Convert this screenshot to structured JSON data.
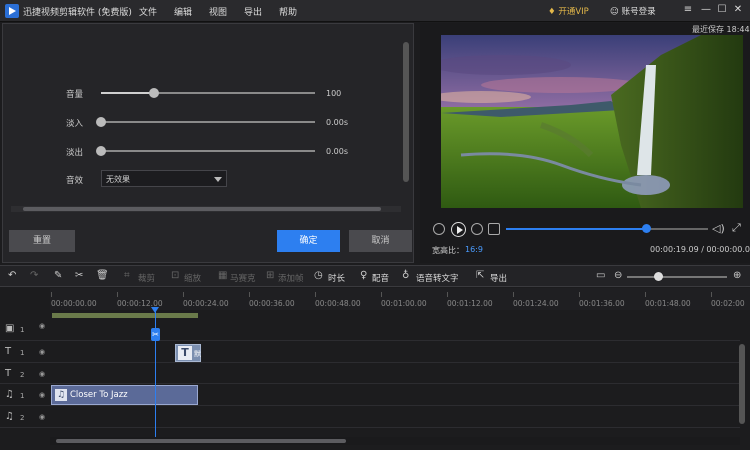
{
  "app": {
    "title": "迅捷视频剪辑软件 (免费版)"
  },
  "menu": [
    "文件",
    "编辑",
    "视图",
    "导出",
    "帮助"
  ],
  "account": {
    "vip_label": "开通VIP",
    "login_label": "账号登录"
  },
  "window_controls": [
    "≡",
    "—",
    "☐",
    "✕"
  ],
  "audio_panel": {
    "volume": {
      "label": "音量",
      "value": "100",
      "level": 1.0
    },
    "fade_in": {
      "label": "淡入",
      "value": "0.00s",
      "level": 0
    },
    "fade_out": {
      "label": "淡出",
      "value": "0.00s",
      "level": 0
    },
    "effect": {
      "label": "音效",
      "value": "无效果"
    },
    "reset_label": "重置",
    "ok_label": "确定",
    "cancel_label": "取消"
  },
  "preview": {
    "last_saved": "最近保存 18:44",
    "aspect_label": "宽高比：",
    "aspect_value": "16:9",
    "time": "00:00:19.09 / 00:00:00.00",
    "progress": 0.7
  },
  "toolbar": {
    "crop": "裁剪",
    "zoom": "缩放",
    "mosaic": "马赛克",
    "freeze": "添加帧",
    "duration": "时长",
    "dub": "配音",
    "speech_to_text": "语音转文字",
    "export": "导出",
    "zoom_level": 0.33
  },
  "ruler": {
    "ticks": [
      "00:00:00.00",
      "00:00:12.00",
      "00:00:24.00",
      "00:00:36.00",
      "00:00:48.00",
      "00:01:00.00",
      "00:01:12.00",
      "00:01:24.00",
      "00:01:36.00",
      "00:01:48.00",
      "00:02:00"
    ]
  },
  "tracks": {
    "video1": "1",
    "text1": "1",
    "text2": "2",
    "music1": "1",
    "music2": "2"
  },
  "clips": {
    "text_clip_label": "默",
    "audio_clip_name": "Closer To Jazz"
  }
}
